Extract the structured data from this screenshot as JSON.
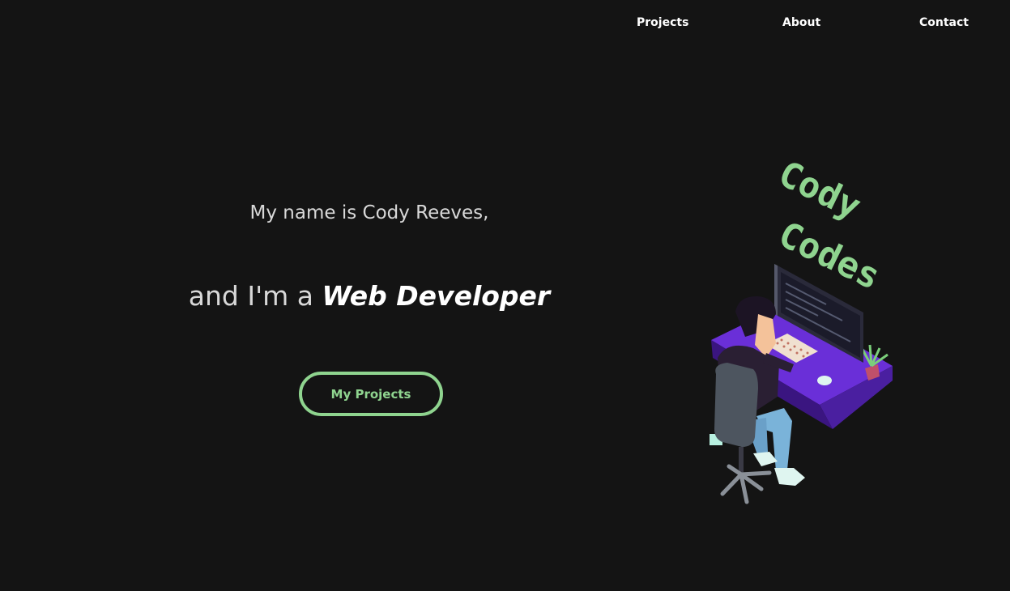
{
  "nav": {
    "items": [
      {
        "label": "Projects"
      },
      {
        "label": "About"
      },
      {
        "label": "Contact"
      }
    ]
  },
  "hero": {
    "intro": "My name is Cody Reeves,",
    "role_prefix": "and I'm a ",
    "role_title": "Web Developer",
    "cta_label": "My Projects"
  },
  "illustration": {
    "logo_line1": "Cody",
    "logo_line2": "Codes"
  },
  "colors": {
    "background": "#141414",
    "accent": "#8fd48f",
    "desk_purple": "#6a2fd8"
  }
}
